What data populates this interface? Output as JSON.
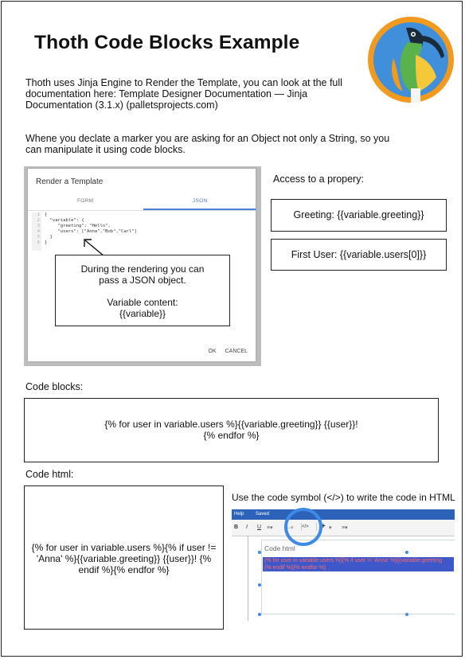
{
  "title": "Thoth Code Blocks Example",
  "intro_text": "Thoth uses Jinja Engine to Render the Template, you can look at the full documentation here: Template Designer Documentation — Jinja Documentation (3.1.x) (palletsprojects.com)",
  "marker_text": "Whene you declate a marker you are asking for an Object not only a String, so you can manipulate it using code blocks.",
  "dialog": {
    "title": "Render a Template",
    "tab_form": "FORM",
    "tab_json": "JSON",
    "line_numbers": "1\n2\n3\n4\n5\n6",
    "code": "{\n  \"variable\": {\n     \"greeting\": \"Hello\",\n     \"users\": [\"Anna\",\"Bob\",\"Carl\"]\n  }\n}",
    "ok": "OK",
    "cancel": "CANCEL"
  },
  "callout": {
    "line1": "During the rendering you can pass a JSON object.",
    "line2": "Variable content:",
    "line3": "{{variable}}"
  },
  "access_label": "Access to a propery:",
  "greeting_box": "Greeting: {{variable.greeting}}",
  "first_user_box": "First User: {{variable.users[0]}}",
  "code_blocks_label": "Code blocks:",
  "code_blocks_line1": "{% for user in variable.users %}{{variable.greeting}} {{user}}!",
  "code_blocks_line2": "{% endfor %}",
  "code_html_label": "Code html:",
  "code_html_content": "{% for user in variable.users %}{% if user != 'Anna' %}{{variable.greeting}} {{user}}! {% endif %}{% endfor %}",
  "code_symbol_hint": "Use the code symbol (</>) to write the code in HTML",
  "editor": {
    "menu_help": "Help",
    "menu_saved": "Saved",
    "tool_bold": "B",
    "tool_italic": "I",
    "tool_underline": "U",
    "tool_code": "</>",
    "tool_plus": "+",
    "heading": "Code html",
    "selected_line1": "{% for user in variable.users %}{% if user != 'Anna' %}{{variable.greeting",
    "selected_line2": "{% endif %}{% endfor %}"
  },
  "colors": {
    "accent_blue": "#3d8be6",
    "selection": "#3e58c9",
    "logo_orange": "#f29a1e"
  },
  "logo_icon": "ibis-bird-logo"
}
